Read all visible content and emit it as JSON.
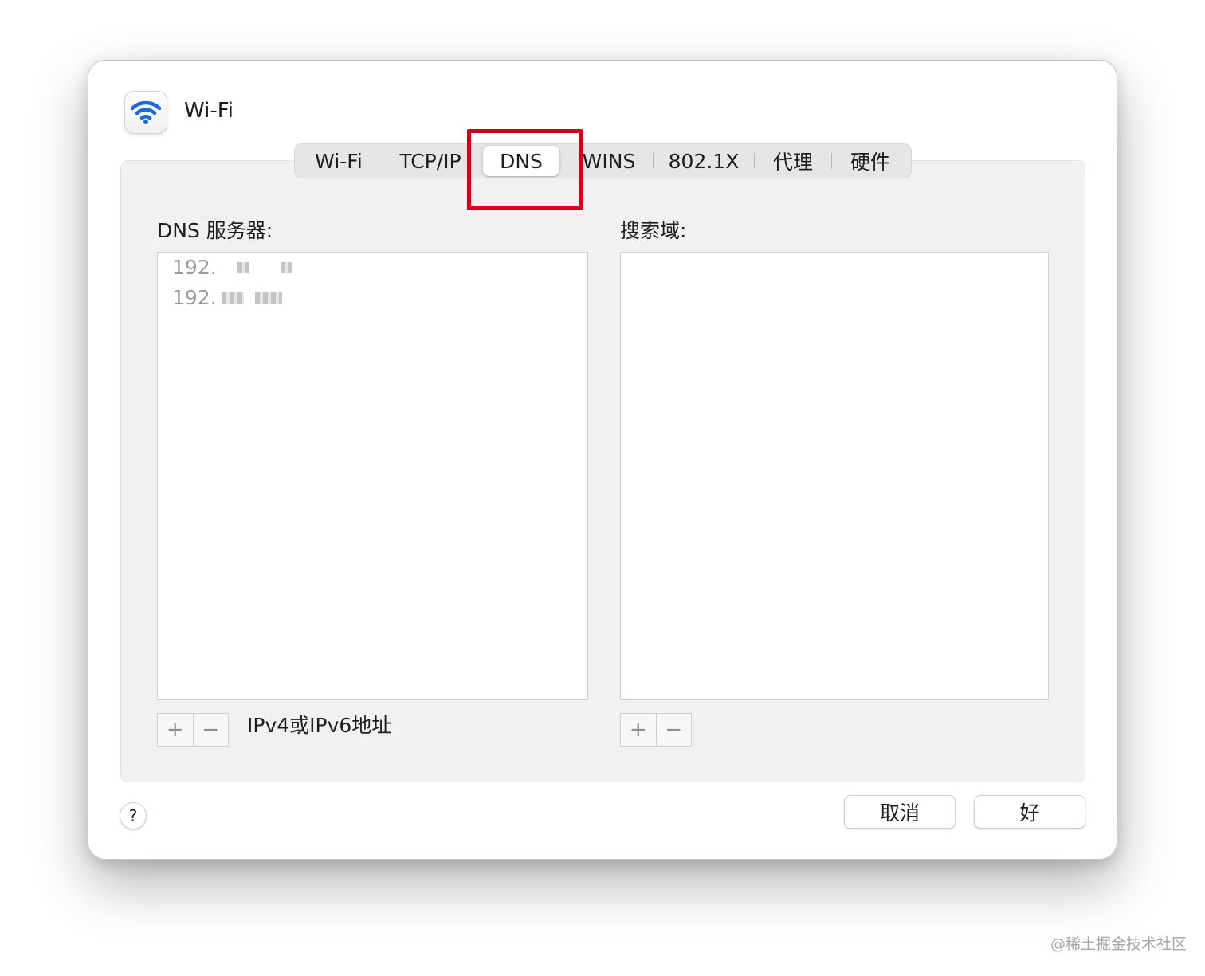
{
  "window": {
    "title": "Wi-Fi"
  },
  "tabs": [
    {
      "label": "Wi-Fi"
    },
    {
      "label": "TCP/IP"
    },
    {
      "label": "DNS"
    },
    {
      "label": "WINS"
    },
    {
      "label": "802.1X"
    },
    {
      "label": "代理"
    },
    {
      "label": "硬件"
    }
  ],
  "active_tab": "DNS",
  "dns_servers": {
    "label": "DNS 服务器:",
    "entries": [
      "192.",
      "192."
    ],
    "hint": "IPv4或IPv6地址",
    "add_label": "+",
    "remove_label": "−"
  },
  "search_domains": {
    "label": "搜索域:",
    "add_label": "+",
    "remove_label": "−"
  },
  "footer": {
    "help_label": "?",
    "cancel_label": "取消",
    "ok_label": "好"
  },
  "watermark": "@稀土掘金技术社区",
  "colors": {
    "highlight": "#d0021b",
    "wifi_icon": "#1a6ad9"
  }
}
